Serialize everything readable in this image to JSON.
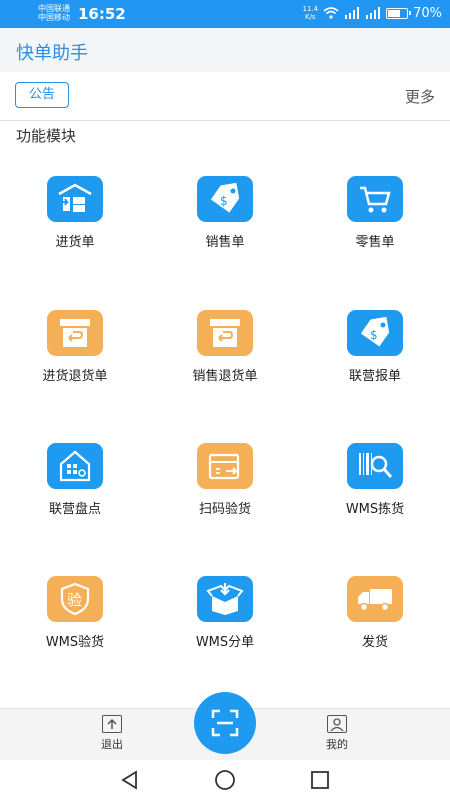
{
  "status": {
    "carrier1": "中国联通",
    "carrier2": "中国移动",
    "time": "16:52",
    "speed_value": "11.4",
    "speed_unit": "K/s",
    "battery": "70%",
    "battery_level": 0.7
  },
  "app": {
    "title": "快单助手"
  },
  "notice": {
    "label": "公告",
    "more": "更多"
  },
  "section": {
    "title": "功能模块"
  },
  "modules": [
    {
      "label": "进货单",
      "icon": "warehouse-inbound-icon",
      "color": "#1e9af0"
    },
    {
      "label": "销售单",
      "icon": "price-tag-icon",
      "color": "#1e9af0"
    },
    {
      "label": "零售单",
      "icon": "shopping-cart-icon",
      "color": "#1e9af0"
    },
    {
      "label": "进货退货单",
      "icon": "return-box-icon",
      "color": "#f5b057"
    },
    {
      "label": "销售退货单",
      "icon": "return-box-icon",
      "color": "#f5b057"
    },
    {
      "label": "联营报单",
      "icon": "price-tag-icon",
      "color": "#1e9af0"
    },
    {
      "label": "联营盘点",
      "icon": "house-inventory-icon",
      "color": "#1e9af0"
    },
    {
      "label": "扫码验货",
      "icon": "scan-box-icon",
      "color": "#f5b057"
    },
    {
      "label": "WMS拣货",
      "icon": "barcode-search-icon",
      "color": "#1e9af0"
    },
    {
      "label": "WMS验货",
      "icon": "shield-verify-icon",
      "color": "#f5b057",
      "badge": "验"
    },
    {
      "label": "WMS分单",
      "icon": "open-box-icon",
      "color": "#1e9af0"
    },
    {
      "label": "发货",
      "icon": "delivery-truck-icon",
      "color": "#f5b057"
    }
  ],
  "bottom_tabs": {
    "logout": "退出",
    "mine": "我的"
  }
}
